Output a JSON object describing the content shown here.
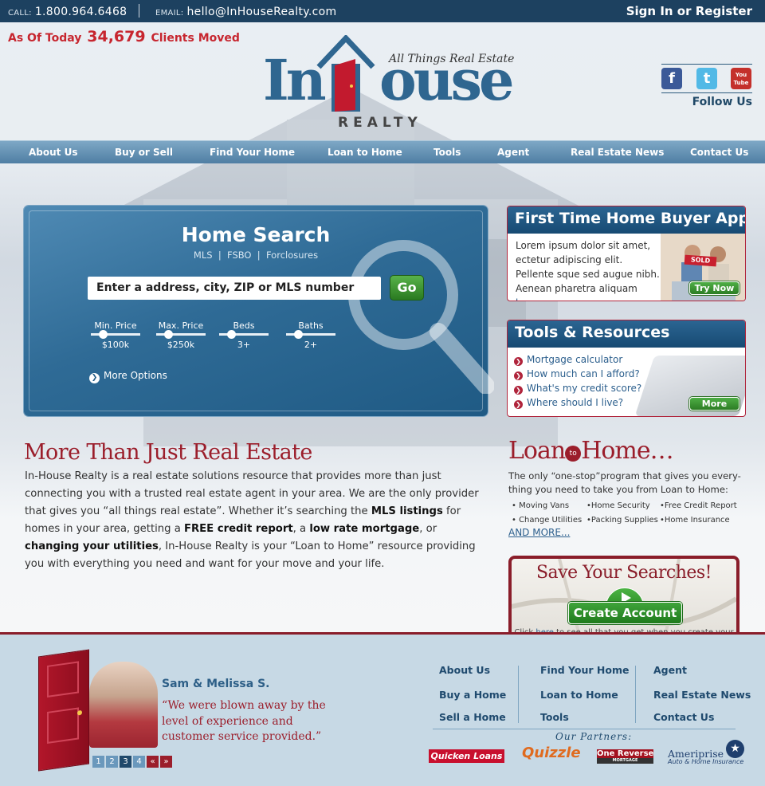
{
  "topbar": {
    "call_label": "CALL:",
    "phone": "1.800.964.6468",
    "email_label": "EMAIL:",
    "email": "hello@InHouseRealty.com",
    "signin": "Sign In or Register"
  },
  "counter": {
    "prefix": "As Of Today",
    "number": "34,679",
    "suffix": "Clients Moved"
  },
  "logo": {
    "brand_left": "In",
    "brand_right": "ouse",
    "realty": "REALTY",
    "tagline": "All Things Real Estate"
  },
  "social": {
    "facebook": "f",
    "twitter": "t",
    "youtube": "You Tube",
    "follow": "Follow Us"
  },
  "nav": [
    "About Us",
    "Buy or Sell",
    "Find Your Home",
    "Loan to Home",
    "Tools",
    "Agent",
    "Real Estate News",
    "Contact Us"
  ],
  "search": {
    "title": "Home Search",
    "subtitle": "MLS  |  FSBO  |  Forclosures",
    "input_placeholder": "Enter a address, city, ZIP or MLS number",
    "go": "Go",
    "sliders": [
      {
        "label": "Min. Price",
        "value": "$100k"
      },
      {
        "label": "Max. Price",
        "value": "$250k"
      },
      {
        "label": "Beds",
        "value": "3+"
      },
      {
        "label": "Baths",
        "value": "2+"
      }
    ],
    "more_options": "More Options"
  },
  "app_panel": {
    "title": "First Time Home Buyer App",
    "text": "Lorem ipsum dolor sit amet, ectetur adipiscing elit. Pellente sque sed augue nibh. Aenean pharetra aliquam",
    "link": "here",
    "sold": "SOLD",
    "button": "Try Now"
  },
  "tools_panel": {
    "title": "Tools & Resources",
    "items": [
      "Mortgage calculator",
      "How much can I afford?",
      "What's my credit score?",
      "Where should I live?"
    ],
    "button": "More"
  },
  "main": {
    "title": "More Than Just Real Estate",
    "p1": "In-House Realty is a real estate solutions resource that provides more than just connecting you with a trusted real estate agent in your area. We are the only provider that gives you “all things real estate”. Whether it’s searching the ",
    "b1": "MLS listings",
    "p2": " for homes in your area, getting a ",
    "b2": "FREE credit report",
    "p3": ", a ",
    "b3": "low rate mortgage",
    "p4": ", or ",
    "b4": "changing your utilities",
    "p5": ", In-House Realty is your “Loan to Home” resource providing you with everything you need and want for your move and your life."
  },
  "loan": {
    "title_left": "Loan",
    "title_to": "to",
    "title_right": "Home…",
    "text": "The only “one-stop”program that gives you every-thing you need to take you from Loan to Home:",
    "items": [
      "Moving Vans",
      "Home Security",
      "Free Credit Report",
      "Change Utilities",
      "Packing Supplies",
      "Home Insurance"
    ],
    "more": "AND MORE..."
  },
  "save": {
    "title": "Save Your Searches!",
    "button": "Create Account",
    "fine_pre": "Click ",
    "fine_link": "here",
    "fine_post": " to see all that you get when you create your In-House Concerige account today."
  },
  "testimonial": {
    "name": "Sam & Melissa S.",
    "quote": "“We were blown away by the level of experience and customer service provided.”",
    "pages": [
      "1",
      "2",
      "3",
      "4"
    ],
    "prev": "«",
    "next": "»"
  },
  "footer_links": {
    "col1": [
      "About Us",
      "Buy a Home",
      "Sell a Home"
    ],
    "col2": [
      "Find Your Home",
      "Loan to Home",
      "Tools"
    ],
    "col3": [
      "Agent",
      "Real Estate News",
      "Contact Us"
    ]
  },
  "partners": {
    "label": "Our Partners:",
    "logos": [
      "Quicken Loans",
      "Quizzle",
      "One Reverse",
      "Ameriprise"
    ],
    "reverse_sub": "MORTGAGE",
    "ameriprise_sub": "Auto & Home Insurance"
  },
  "colors": {
    "navy": "#1d4160",
    "accent_red": "#9b1e2b",
    "link_blue": "#2c5f8d",
    "green": "#3fa43a"
  }
}
